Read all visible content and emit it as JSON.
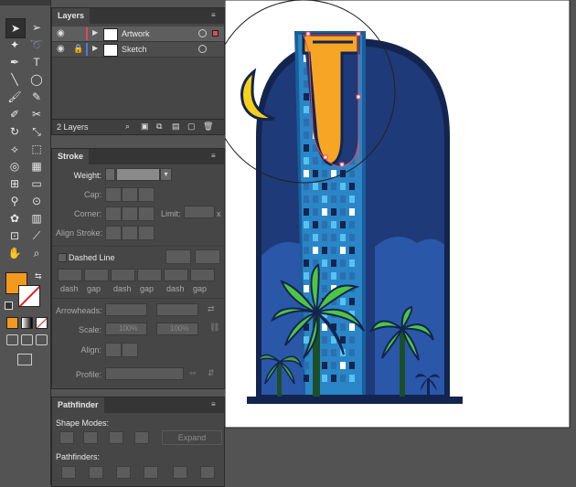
{
  "layers_panel": {
    "tab": "Layers",
    "rows": [
      {
        "name": "Artwork",
        "selected": true,
        "color": "#e0485a"
      },
      {
        "name": "Sketch",
        "selected": false,
        "color": "#4a7adf"
      }
    ],
    "count_label": "2 Layers"
  },
  "stroke_panel": {
    "tab": "Stroke",
    "weight_label": "Weight:",
    "cap_label": "Cap:",
    "corner_label": "Corner:",
    "limit_label": "Limit:",
    "limit_unit": "x",
    "align_label": "Align Stroke:",
    "dashed_line_label": "Dashed Line",
    "dash_labels": [
      "dash",
      "gap",
      "dash",
      "gap",
      "dash",
      "gap"
    ],
    "arrowheads_label": "Arrowheads:",
    "scale_label": "Scale:",
    "scale_values": [
      "100%",
      "100%"
    ],
    "align_label2": "Align:",
    "profile_label": "Profile:"
  },
  "pathfinder_panel": {
    "tab": "Pathfinder",
    "shape_modes_label": "Shape Modes:",
    "expand_label": "Expand",
    "pathfinders_label": "Pathfinders:"
  },
  "toolbar": {
    "fill_color": "#f39a1e",
    "tools": [
      "selection-tool",
      "direct-selection-tool",
      "magic-wand-tool",
      "lasso-tool",
      "pen-tool",
      "type-tool",
      "line-tool",
      "ellipse-tool",
      "paintbrush-tool",
      "pencil-tool",
      "blob-brush-tool",
      "scissors-tool",
      "rotate-tool",
      "scale-tool",
      "width-tool",
      "free-transform-tool",
      "shape-builder-tool",
      "perspective-grid-tool",
      "mesh-tool",
      "gradient-tool",
      "eyedropper-tool",
      "blend-tool",
      "symbol-sprayer-tool",
      "column-graph-tool",
      "artboard-tool",
      "slice-tool",
      "hand-tool",
      "zoom-tool"
    ]
  },
  "colors": {
    "sky": "#1e3a78",
    "tower": "#2a7fb8",
    "moon": "#f5d11b",
    "palm_leaf": "#4cc742",
    "trunk": "#1a4f2a",
    "ground": "#13244f"
  }
}
